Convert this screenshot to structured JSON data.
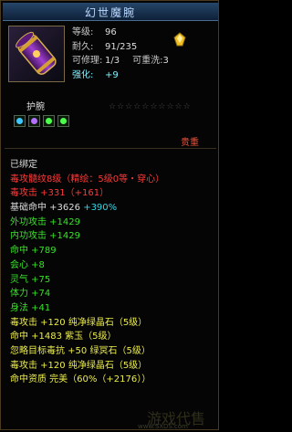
{
  "item": {
    "name": "幻世魔腕",
    "level_label": "等级:",
    "level_value": "96",
    "durability_label": "耐久:",
    "durability_value": "91/235",
    "repair_label": "可修理:",
    "repair_value": "1/3",
    "reforge_label": "可重洗:",
    "reforge_value": "3",
    "enhance_label": "强化:",
    "enhance_value": "+9",
    "category": "护腕",
    "stars": "☆☆☆☆☆☆☆☆☆☆",
    "price": "贵重",
    "icon": "purple-bracer-icon",
    "badge_icon": "gold-gem-icon"
  },
  "sockets": [
    {
      "icon": "sapphire-gem-icon",
      "color": "#3ec8ff"
    },
    {
      "icon": "amethyst-gem-icon",
      "color": "#b470ff"
    },
    {
      "icon": "emerald-gem-icon",
      "color": "#4cff4c"
    },
    {
      "icon": "emerald-gem-icon",
      "color": "#4cff4c"
    }
  ],
  "attributes": [
    {
      "text": "已绑定",
      "color": "white"
    },
    {
      "text": "毒攻髓纹8级（精绘：5级0等・穿心）",
      "color": "red"
    },
    {
      "text": "毒攻击 +331（+161）",
      "color": "red"
    },
    {
      "text": "基础命中 +3626 ",
      "extra": "+390%",
      "color": "white"
    },
    {
      "text": "外功攻击 +1429",
      "color": "green"
    },
    {
      "text": "内功攻击 +1429",
      "color": "green"
    },
    {
      "text": "命中 +789",
      "color": "green"
    },
    {
      "text": "会心 +8",
      "color": "green"
    },
    {
      "text": "灵气 +75",
      "color": "green"
    },
    {
      "text": "体力 +74",
      "color": "green"
    },
    {
      "text": "身法 +41",
      "color": "green"
    },
    {
      "text": "毒攻击 +120 纯净绿晶石（5级）",
      "color": "yellow"
    },
    {
      "text": "命中 +1483 紫玉（5级）",
      "color": "yellow"
    },
    {
      "text": "忽略目标毒抗 +50 绿冥石（5级）",
      "color": "yellow"
    },
    {
      "text": "毒攻击 +120 纯净绿晶石（5级）",
      "color": "yellow"
    },
    {
      "text": "命中资质 完美（60%（+2176））",
      "color": "yellow"
    }
  ],
  "watermark": "游戏代售",
  "watermark_url": "www.SXDS.com",
  "colors": {
    "red": "#ff3838",
    "green": "#38e028",
    "yellow": "#ecec4a",
    "cyan": "#31d7ea",
    "title": "#b9d8ff"
  }
}
